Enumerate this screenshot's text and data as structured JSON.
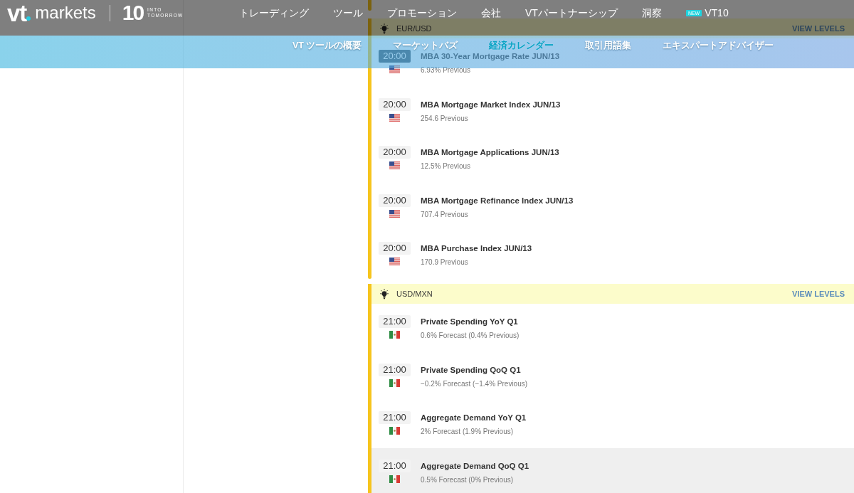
{
  "header": {
    "logo": {
      "mark": "vt",
      "wordmark": "markets",
      "number": "10",
      "tagline": [
        "INTO",
        "TOMORROW"
      ]
    },
    "nav": [
      {
        "label": "トレーディング"
      },
      {
        "label": "ツール"
      },
      {
        "label": "プロモーション"
      },
      {
        "label": "会社"
      },
      {
        "label": "VTパートナーシップ"
      },
      {
        "label": "洞察"
      },
      {
        "label": "VT10",
        "badge": "NEW"
      }
    ]
  },
  "sub_nav": [
    {
      "label": "VT ツールの概要",
      "selected": false
    },
    {
      "label": "マーケットバズ",
      "selected": false
    },
    {
      "label": "経済カレンダー",
      "selected": true
    },
    {
      "label": "取引用語集",
      "selected": false
    },
    {
      "label": "エキスパートアドバイザー",
      "selected": false
    }
  ],
  "calendar": {
    "groups": [
      {
        "pair": "EUR/USD",
        "link": "VIEW LEVELS",
        "events": [
          {
            "time": "20:00",
            "kind": "us",
            "title": "MBA 30-Year Mortgage Rate JUN/13",
            "detail": "6.93% Previous",
            "current": true,
            "highlighted": false
          },
          {
            "time": "20:00",
            "kind": "us",
            "title": "MBA Mortgage Market Index JUN/13",
            "detail": "254.6 Previous",
            "current": false,
            "highlighted": false
          },
          {
            "time": "20:00",
            "kind": "us",
            "title": "MBA Mortgage Applications JUN/13",
            "detail": "12.5% Previous",
            "current": false,
            "highlighted": false
          },
          {
            "time": "20:00",
            "kind": "us",
            "title": "MBA Mortgage Refinance Index JUN/13",
            "detail": "707.4 Previous",
            "current": false,
            "highlighted": false
          },
          {
            "time": "20:00",
            "kind": "us",
            "title": "MBA Purchase Index JUN/13",
            "detail": "170.9 Previous",
            "current": false,
            "highlighted": false
          }
        ]
      },
      {
        "pair": "USD/MXN",
        "link": "VIEW LEVELS",
        "events": [
          {
            "time": "21:00",
            "kind": "mx",
            "title": "Private Spending YoY Q1",
            "detail": "0.6% Forecast (0.4% Previous)",
            "current": false,
            "highlighted": false
          },
          {
            "time": "21:00",
            "kind": "mx",
            "title": "Private Spending QoQ Q1",
            "detail": "−0.2% Forecast (−1.4% Previous)",
            "current": false,
            "highlighted": false
          },
          {
            "time": "21:00",
            "kind": "mx",
            "title": "Aggregate Demand YoY Q1",
            "detail": "2% Forecast (1.9% Previous)",
            "current": false,
            "highlighted": false
          },
          {
            "time": "21:00",
            "kind": "mx",
            "title": "Aggregate Demand QoQ Q1",
            "detail": "0.5% Forecast (0% Previous)",
            "current": false,
            "highlighted": true
          }
        ]
      }
    ]
  }
}
